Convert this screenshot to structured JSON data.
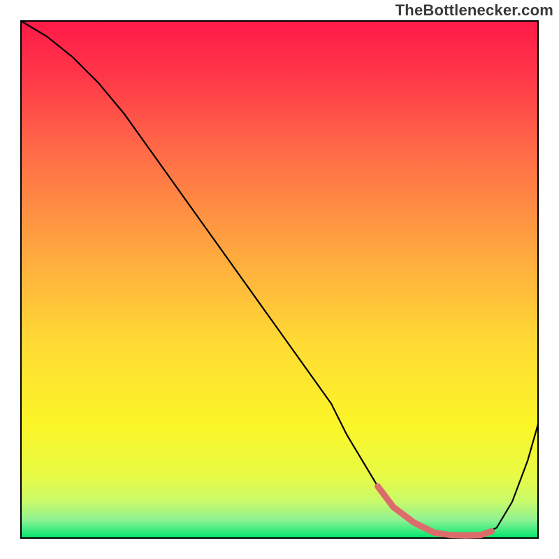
{
  "brand": "TheBottlenecker.com",
  "chart_data": {
    "type": "line",
    "title": "",
    "xlabel": "",
    "ylabel": "",
    "xlim": [
      0,
      100
    ],
    "ylim": [
      0,
      100
    ],
    "grid": false,
    "legend": false,
    "background_gradient": {
      "stops": [
        {
          "offset": 0.0,
          "color": "#ff1a48"
        },
        {
          "offset": 0.1,
          "color": "#ff3549"
        },
        {
          "offset": 0.25,
          "color": "#ff6a47"
        },
        {
          "offset": 0.45,
          "color": "#ffa93f"
        },
        {
          "offset": 0.62,
          "color": "#ffda34"
        },
        {
          "offset": 0.78,
          "color": "#fbf527"
        },
        {
          "offset": 0.88,
          "color": "#e8fb45"
        },
        {
          "offset": 0.93,
          "color": "#c8fa6b"
        },
        {
          "offset": 0.965,
          "color": "#8ef292"
        },
        {
          "offset": 1.0,
          "color": "#00e76e"
        }
      ]
    },
    "series": [
      {
        "name": "curve",
        "stroke": "#000000",
        "stroke_width": 2.2,
        "x": [
          0,
          5,
          10,
          15,
          20,
          25,
          30,
          35,
          40,
          45,
          50,
          55,
          60,
          63,
          66,
          69,
          72,
          76,
          80,
          83,
          86,
          89,
          92,
          95,
          98,
          100
        ],
        "values": [
          100,
          97,
          93,
          88,
          82,
          75,
          68,
          61,
          54,
          47,
          40,
          33,
          26,
          20,
          15,
          10,
          6,
          3,
          1,
          0.6,
          0.5,
          0.6,
          2,
          7,
          15,
          22
        ]
      },
      {
        "name": "trough-highlight",
        "stroke": "#de6b6b",
        "stroke_width": 9,
        "linecap": "round",
        "x": [
          69,
          72,
          76,
          80,
          83,
          86,
          89,
          91
        ],
        "values": [
          10,
          6,
          3,
          1,
          0.6,
          0.5,
          0.6,
          1.3
        ]
      }
    ]
  }
}
